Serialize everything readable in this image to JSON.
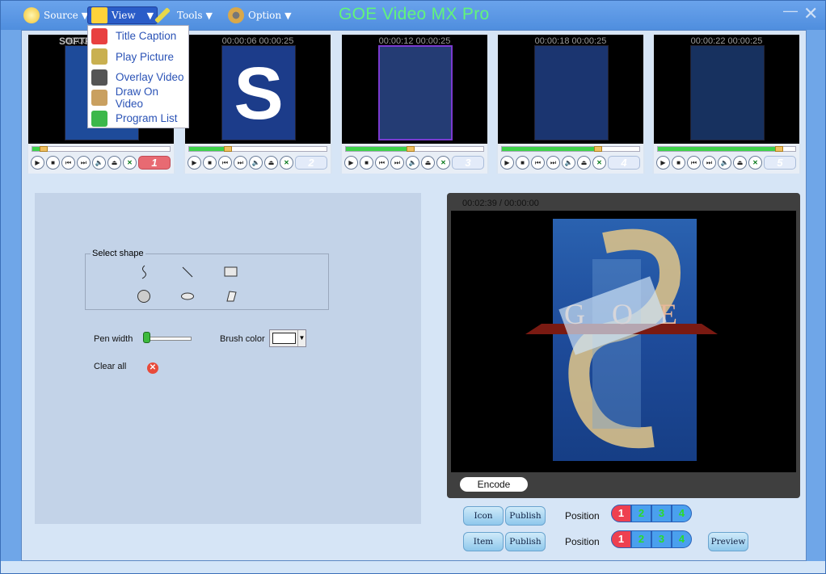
{
  "window": {
    "title": "GOE Video MX Pro"
  },
  "menu": [
    {
      "label": "Source",
      "icon": "cd-icon",
      "color": "#f2c230"
    },
    {
      "label": "View",
      "icon": "film-icon",
      "color": "#2f63c9"
    },
    {
      "label": "Tools",
      "icon": "wrench-icon",
      "color": "#e8d84a"
    },
    {
      "label": "Option",
      "icon": "gear-icon",
      "color": "#d9a84a"
    }
  ],
  "dropdown": [
    {
      "label": "Title Caption",
      "icon": "caption-icon",
      "color": "#e84040"
    },
    {
      "label": "Play Picture",
      "icon": "picture-icon",
      "color": "#c9b050"
    },
    {
      "label": "Overlay Video",
      "icon": "film-reel-icon",
      "color": "#555"
    },
    {
      "label": "Draw On Video",
      "icon": "notepad-icon",
      "color": "#c9a060"
    },
    {
      "label": "Program List",
      "icon": "list-icon",
      "color": "#3cb84a"
    }
  ],
  "thumbs": [
    {
      "time": "00:00:06 00:00:25",
      "num": "1",
      "progress": 0.08,
      "active": true,
      "overlay": "SOFTPEDIA"
    },
    {
      "time": "00:00:06 00:00:25",
      "num": "2",
      "progress": 0.28,
      "active": false
    },
    {
      "time": "00:00:12 00:00:25",
      "num": "3",
      "progress": 0.47,
      "active": false
    },
    {
      "time": "00:00:18 00:00:25",
      "num": "4",
      "progress": 0.7,
      "active": false
    },
    {
      "time": "00:00:22 00:00:25",
      "num": "5",
      "progress": 0.88,
      "active": false
    }
  ],
  "draw": {
    "shape_legend": "Select shape",
    "pen_label": "Pen width",
    "brush_label": "Brush color",
    "clear_label": "Clear all",
    "pen_level": 0.1
  },
  "preview": {
    "time": "00:02:39 / 00:00:00",
    "encode": "Encode",
    "overlay_text": "G O E"
  },
  "publish": {
    "row1": {
      "left": "Icon",
      "publish": "Publish",
      "position": "Position"
    },
    "row2": {
      "left": "Item",
      "publish": "Publish",
      "position": "Position"
    },
    "positions": [
      "1",
      "2",
      "3",
      "4"
    ],
    "preview": "Preview"
  }
}
